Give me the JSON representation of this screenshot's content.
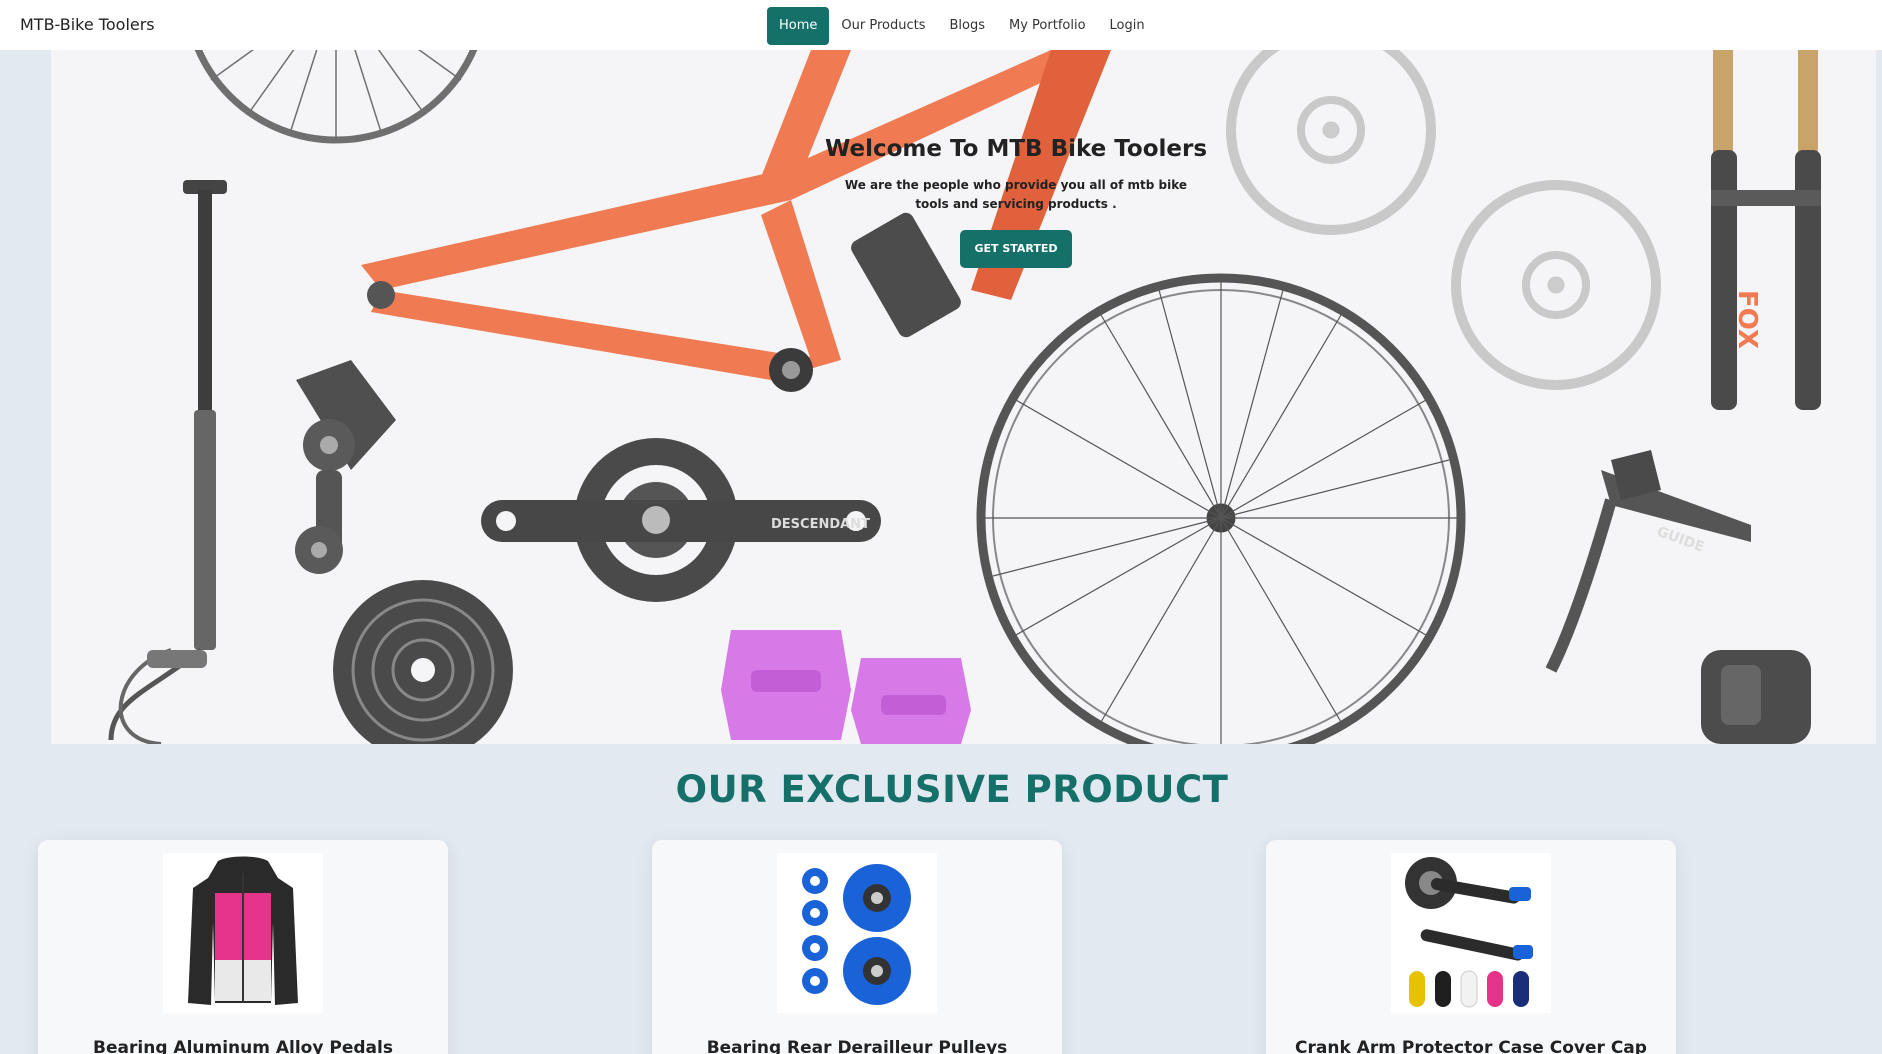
{
  "navbar": {
    "brand": "MTB-Bike Toolers",
    "links": [
      {
        "label": "Home",
        "active": true
      },
      {
        "label": "Our Products",
        "active": false
      },
      {
        "label": "Blogs",
        "active": false
      },
      {
        "label": "My Portfolio",
        "active": false
      },
      {
        "label": "Login",
        "active": false
      }
    ]
  },
  "hero": {
    "title": "Welcome To MTB Bike Toolers",
    "subtitle": "We are the people who provide you all of mtb bike tools and servicing products .",
    "cta_label": "GET STARTED",
    "print_texts": {
      "crank": "DESCENDANT",
      "brake": "GUIDE",
      "fork": "FOX"
    }
  },
  "section": {
    "title": "OUR EXCLUSIVE PRODUCT"
  },
  "products": [
    {
      "name": "Bearing Aluminum Alloy Pedals",
      "image": "puffer-jacket-image"
    },
    {
      "name": "Bearing Rear Derailleur Pulleys",
      "image": "pulley-wheels-image"
    },
    {
      "name": "Crank Arm Protector Case Cover Cap",
      "image": "crank-arm-image"
    }
  ],
  "colors": {
    "accent": "#15706a",
    "page_bg": "#e3e9f1",
    "hero_bg": "#f5f5f7",
    "frame_orange": "#f07a52",
    "pedal_purple": "#d879e8",
    "pulley_blue": "#1a62d8",
    "jacket_pink": "#e6338a"
  }
}
